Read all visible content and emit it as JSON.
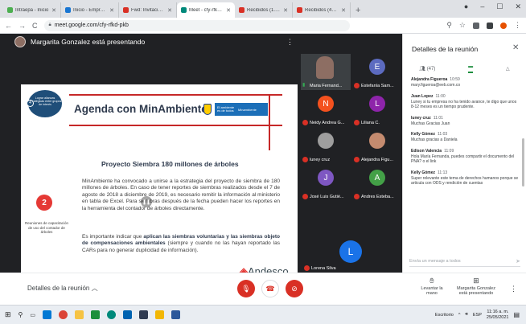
{
  "browser": {
    "tabs": [
      {
        "label": "Intraepa - Inicio",
        "color": "#4caf50",
        "active": false
      },
      {
        "label": "Inicio - Empresas Públ",
        "color": "#1976d2",
        "active": false
      },
      {
        "label": "Fwd: Invitación Cámar",
        "color": "#d93025",
        "active": false
      },
      {
        "label": "Meet - cfy-rfkd-p",
        "color": "#00897b",
        "active": true
      },
      {
        "label": "Recibidos (1.105) - co",
        "color": "#d93025",
        "active": false
      },
      {
        "label": "Recibidos (41) - respo",
        "color": "#d93025",
        "active": false
      }
    ],
    "new_tab": "+",
    "url": "meet.google.com/cfy-rfkd-pkb"
  },
  "meet": {
    "presenter_text": "Margarita Gonzalez está presentando",
    "slide": {
      "goal_badge": "Lograr alianzas estratégicas entre grupos de interés",
      "goal_number": "4",
      "title": "Agenda con MinAmbiente",
      "ministry_logo": "El ambiente es de todos",
      "ministry_name": "Minambiente",
      "project_title": "Proyecto Siembra 180 millones de árboles",
      "paragraph1": "MinAmbiente ha convocado a unirse a la estrategia del proyecto de siembra de 180 millones de árboles. En caso de tener reportes de siembras realizados desde el 7 de agosto de 2018 a diciembre de 2019, es necesario remitir la información al ministerio en tabla de Excel. Para siembras después de la fecha pueden hacer los reportes en la herramienta del contador de árboles directamente.",
      "paragraph2_pre": "Es importante indicar que ",
      "paragraph2_bold": "aplican las siembras voluntarias y las siembras objeto de compensaciones ambientales",
      "paragraph2_post": " (siempre y cuando no las hayan reportado las CARs para no generar duplicidad de información).",
      "step_number": "2",
      "step_caption": "Reuniones de capacitación de uso del contador de árboles",
      "logo": "Andesco"
    },
    "participants": [
      {
        "name": "Maria Fernand...",
        "initial": "",
        "color": "#3c4043",
        "video": true
      },
      {
        "name": "Estefanía Sam...",
        "initial": "E",
        "color": "#5c6bc0"
      },
      {
        "name": "Neidy Andrea G...",
        "initial": "N",
        "color": "#f4511e"
      },
      {
        "name": "Liliana C.",
        "initial": "L",
        "color": "#8e24aa"
      },
      {
        "name": "luney cruz",
        "initial": "",
        "color": "#9e9e9e"
      },
      {
        "name": "Alejandra Figu...",
        "initial": "",
        "color": "#9e9e9e"
      },
      {
        "name": "José Luis Gutié...",
        "initial": "J",
        "color": "#7e57c2"
      },
      {
        "name": "Andres Esteba...",
        "initial": "A",
        "color": "#43a047"
      }
    ],
    "self_tile": {
      "name": "Lorena Silva",
      "initial": "L"
    },
    "details_label": "Detalles de la reunión",
    "controls": {
      "raise_hand": "Levantar la mano",
      "presenting": "Margarita Gonzalez está presentando"
    }
  },
  "panel": {
    "title": "Detalles de la reunión",
    "participant_count": "(47)",
    "messages": [
      {
        "sender": "Alejandra Figueroa",
        "time": "10:59",
        "text": "mary.figueroa@eeb.com.co"
      },
      {
        "sender": "Juan Lopez",
        "time": "11:00",
        "text": "Luney si tu empresa no ha tenido avance, te digo que unos 8-12 meses es un tiempo prudente."
      },
      {
        "sender": "luney cruz",
        "time": "11:01",
        "text": "Muchas Gracias Juan"
      },
      {
        "sender": "Kelly Gómez",
        "time": "11:03",
        "text": "Muchas gracias a Daniela"
      },
      {
        "sender": "Edison Valencia",
        "time": "11:09",
        "text": "Hola María Fernanda, puedes compartir el documento del PNA? o el link"
      },
      {
        "sender": "Kelly Gómez",
        "time": "11:13",
        "text": "Super relevante este tema de derechos humanos porque se articula con ODS y rendición de cuentas"
      }
    ],
    "input_placeholder": "Envía un mensaje a todos"
  },
  "taskbar": {
    "desktop_label": "Escritorio",
    "lang": "ESP",
    "time": "11:16 a. m.",
    "date": "25/05/2021"
  }
}
